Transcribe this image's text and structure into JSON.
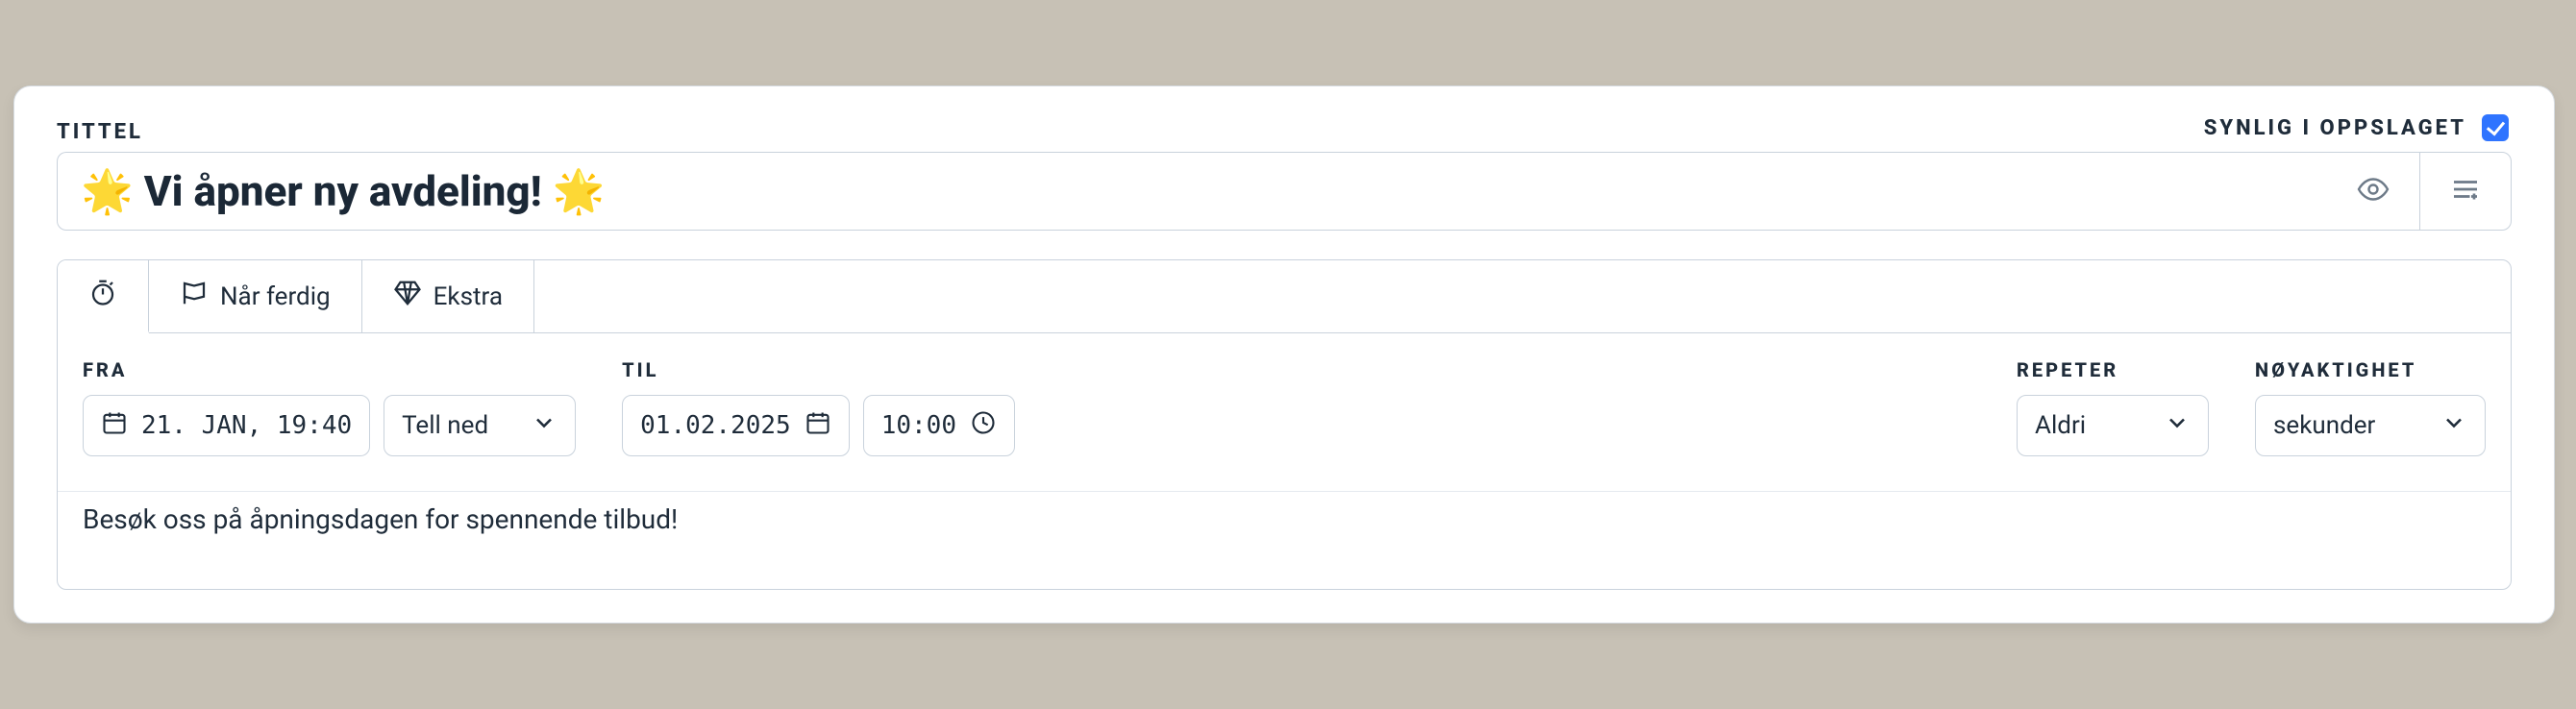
{
  "header": {
    "title_label": "TITTEL",
    "visible_label": "SYNLIG I OPPSLAGET",
    "title_value": "🌟 Vi åpner ny avdeling! 🌟",
    "visible_checked": true
  },
  "tabs": {
    "timer_icon": "stopwatch",
    "when_done_label": "Når ferdig",
    "extra_label": "Ekstra"
  },
  "fields": {
    "from_label": "FRA",
    "from_date": "21. JAN, 19:40",
    "countdown_value": "Tell ned",
    "to_label": "TIL",
    "to_date": "01.02.2025",
    "to_time": "10:00",
    "repeat_label": "REPETER",
    "repeat_value": "Aldri",
    "precision_label": "NØYAKTIGHET",
    "precision_value": "sekunder"
  },
  "body": {
    "text": "Besøk oss på åpningsdagen for spennende tilbud!"
  }
}
